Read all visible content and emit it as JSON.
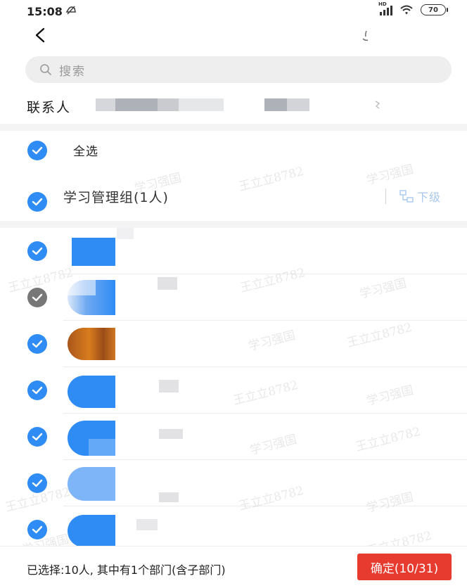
{
  "status_bar": {
    "time": "15:08",
    "mute_icon": "do-not-disturb-icon",
    "network_badge": "HD",
    "battery_level": "70",
    "signal_icon": "signal-icon",
    "wifi_icon": "wifi-icon"
  },
  "header": {
    "back_icon": "chevron-left-icon"
  },
  "search": {
    "placeholder": "搜索",
    "icon": "search-icon"
  },
  "contacts": {
    "label": "联系人"
  },
  "select_all": {
    "label": "全选",
    "checked": true
  },
  "group": {
    "label": "学习管理组(1人)",
    "subordinate_label": "下级",
    "subordinate_icon": "hierarchy-icon",
    "checked": true
  },
  "members": [
    {
      "checked": true,
      "disabled": false,
      "name_fragment": ""
    },
    {
      "checked": true,
      "disabled": true,
      "name_fragment": ""
    },
    {
      "checked": true,
      "disabled": false,
      "name_fragment": ""
    },
    {
      "checked": true,
      "disabled": false,
      "name_fragment": ""
    },
    {
      "checked": true,
      "disabled": false,
      "name_fragment": ""
    },
    {
      "checked": true,
      "disabled": false,
      "name_fragment": ""
    },
    {
      "checked": true,
      "disabled": false,
      "name_fragment": ""
    }
  ],
  "watermarks": [
    "王立立8782",
    "学习强国"
  ],
  "footer": {
    "summary": "已选择:10人, 其中有1个部门(含子部门)",
    "confirm_label": "确定(10/31)"
  },
  "colors": {
    "accent": "#2f8cf4",
    "check_disabled": "#777777",
    "confirm": "#e83b30",
    "subordinate": "#a9c8ee"
  }
}
